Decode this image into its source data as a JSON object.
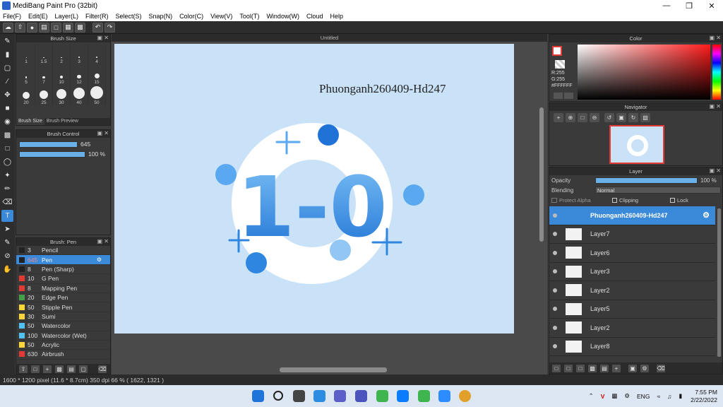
{
  "window": {
    "title": "MediBang Paint Pro (32bit)"
  },
  "menu": [
    "File(F)",
    "Edit(E)",
    "Layer(L)",
    "Filter(R)",
    "Select(S)",
    "Snap(N)",
    "Color(C)",
    "View(V)",
    "Tool(T)",
    "Window(W)",
    "Cloud",
    "Help"
  ],
  "panels": {
    "brush_size": {
      "title": "Brush Size",
      "tabs": [
        "Brush Size",
        "Brush Preview"
      ],
      "sizes": [
        "1",
        "1.5",
        "2",
        "3",
        "4",
        "5",
        "7",
        "10",
        "12",
        "15",
        "20",
        "25",
        "30",
        "40",
        "50"
      ]
    },
    "brush_control": {
      "title": "Brush Control",
      "size_value": "645",
      "opacity_value": "100 %",
      "size_fill": 0.85,
      "opacity_fill": 1.0
    },
    "brush_list": {
      "title": "Brush: Pen",
      "items": [
        {
          "size": "3",
          "name": "Pencil",
          "color": "#222222"
        },
        {
          "size": "645",
          "name": "Pen",
          "color": "#222222",
          "selected": true
        },
        {
          "size": "8",
          "name": "Pen (Sharp)",
          "color": "#222222"
        },
        {
          "size": "10",
          "name": "G Pen",
          "color": "#e53935"
        },
        {
          "size": "8",
          "name": "Mapping Pen",
          "color": "#e53935"
        },
        {
          "size": "20",
          "name": "Edge Pen",
          "color": "#43a047"
        },
        {
          "size": "50",
          "name": "Stipple Pen",
          "color": "#fdd835"
        },
        {
          "size": "30",
          "name": "Sumi",
          "color": "#fdd835"
        },
        {
          "size": "50",
          "name": "Watercolor",
          "color": "#4fc3f7"
        },
        {
          "size": "100",
          "name": "Watercolor (Wet)",
          "color": "#4fc3f7"
        },
        {
          "size": "50",
          "name": "Acrylic",
          "color": "#fdd835"
        },
        {
          "size": "630",
          "name": "Airbrush",
          "color": "#e53935"
        }
      ]
    },
    "color": {
      "title": "Color",
      "r": "R:255",
      "g": "G:255",
      "hex": "#FFFFFF"
    },
    "navigator": {
      "title": "Navigator"
    },
    "layer": {
      "title": "Layer",
      "opacity_label": "Opacity",
      "opacity_value": "100 %",
      "blending_label": "Blending",
      "blending_value": "Normal",
      "protect_alpha": "Protect Alpha",
      "clipping": "Clipping",
      "lock": "Lock",
      "layers": [
        {
          "name": "Phuonganh260409-Hd247",
          "selected": true
        },
        {
          "name": "Layer7"
        },
        {
          "name": "Layer6"
        },
        {
          "name": "Layer3"
        },
        {
          "name": "Layer2"
        },
        {
          "name": "Layer5"
        },
        {
          "name": "Layer2"
        },
        {
          "name": "Layer8"
        }
      ]
    }
  },
  "document": {
    "tab": "Untitled",
    "signature": "Phuonganh260409-Hd247",
    "artwork_text": "1-0"
  },
  "status": {
    "text": "1600 * 1200 pixel   (11.6 * 8.7cm)   350 dpi   66 %   ( 1622, 1321 )"
  },
  "taskbar": {
    "lang": "ENG",
    "time": "7:55 PM",
    "date": "2/22/2022"
  },
  "colors": {
    "accent": "#3b89d9",
    "canvas": "#c9e2f8",
    "art_blue": "#2f86e0"
  }
}
